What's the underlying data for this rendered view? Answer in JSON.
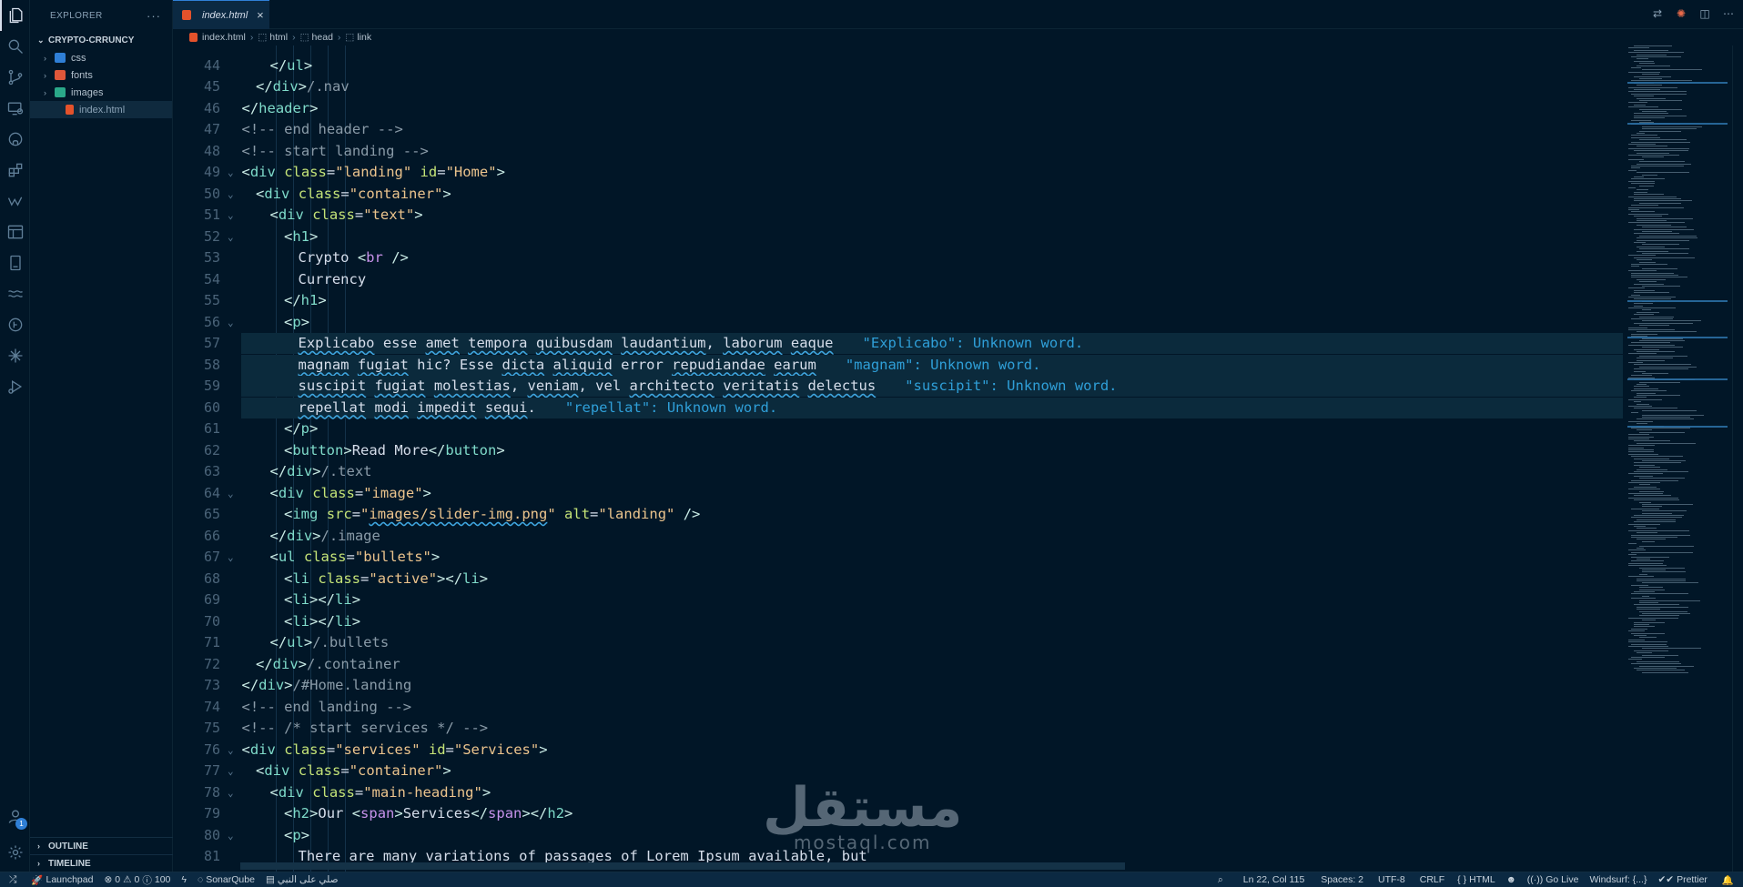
{
  "explorer": {
    "title": "EXPLORER",
    "more": "···",
    "project": "CRYPTO-CRRUNCY",
    "items": [
      {
        "label": "css",
        "type": "folder",
        "color": "#2f7fd6"
      },
      {
        "label": "fonts",
        "type": "folder",
        "color": "#e0573a"
      },
      {
        "label": "images",
        "type": "folder",
        "color": "#2aa889"
      },
      {
        "label": "index.html",
        "type": "file",
        "color": "#e4522b"
      }
    ],
    "outline": "OUTLINE",
    "timeline": "TIMELINE"
  },
  "tab": {
    "label": "index.html",
    "close": "×"
  },
  "breadcrumb": [
    "index.html",
    "html",
    "head",
    "link"
  ],
  "activity_badge": "1",
  "editor": {
    "lines": [
      {
        "n": "44",
        "fold": "",
        "tokens": [
          [
            "tg",
            "</"
          ],
          [
            "tn",
            "ul"
          ],
          [
            "tg",
            ">"
          ]
        ]
      },
      {
        "n": "45",
        "fold": "",
        "tokens": [
          [
            "tg",
            "</"
          ],
          [
            "tn",
            "div"
          ],
          [
            "tg",
            ">"
          ],
          [
            "cm",
            "/.nav"
          ]
        ]
      },
      {
        "n": "46",
        "fold": "",
        "tokens": [
          [
            "tg",
            "</"
          ],
          [
            "tn",
            "header"
          ],
          [
            "tg",
            ">"
          ]
        ]
      },
      {
        "n": "47",
        "fold": "",
        "tokens": [
          [
            "cm",
            "<!-- end header -->"
          ]
        ]
      },
      {
        "n": "48",
        "fold": "",
        "tokens": [
          [
            "cm",
            "<!-- start landing -->"
          ]
        ]
      },
      {
        "n": "49",
        "fold": "v",
        "tokens": [
          [
            "tg",
            "<"
          ],
          [
            "tn",
            "div"
          ],
          [
            "tx",
            " "
          ],
          [
            "at",
            "class"
          ],
          [
            "tx",
            "="
          ],
          [
            "st",
            "\"landing\""
          ],
          [
            "tx",
            " "
          ],
          [
            "at",
            "id"
          ],
          [
            "tx",
            "="
          ],
          [
            "st",
            "\"Home\""
          ],
          [
            "tg",
            ">"
          ]
        ]
      },
      {
        "n": "50",
        "fold": "v",
        "tokens": [
          [
            "tg",
            "<"
          ],
          [
            "tn",
            "div"
          ],
          [
            "tx",
            " "
          ],
          [
            "at",
            "class"
          ],
          [
            "tx",
            "="
          ],
          [
            "st",
            "\"container\""
          ],
          [
            "tg",
            ">"
          ]
        ]
      },
      {
        "n": "51",
        "fold": "v",
        "tokens": [
          [
            "tg",
            "<"
          ],
          [
            "tn",
            "div"
          ],
          [
            "tx",
            " "
          ],
          [
            "at",
            "class"
          ],
          [
            "tx",
            "="
          ],
          [
            "st",
            "\"text\""
          ],
          [
            "tg",
            ">"
          ]
        ]
      },
      {
        "n": "52",
        "fold": "v",
        "tokens": [
          [
            "tg",
            "<"
          ],
          [
            "tn",
            "h1"
          ],
          [
            "tg",
            ">"
          ]
        ]
      },
      {
        "n": "53",
        "fold": "",
        "tokens": [
          [
            "tx",
            "Crypto "
          ],
          [
            "tg",
            "<"
          ],
          [
            "ky",
            "br"
          ],
          [
            "tx",
            " "
          ],
          [
            "tg",
            "/>"
          ]
        ]
      },
      {
        "n": "54",
        "fold": "",
        "tokens": [
          [
            "tx",
            "Currency"
          ]
        ]
      },
      {
        "n": "55",
        "fold": "",
        "tokens": [
          [
            "tg",
            "</"
          ],
          [
            "tn",
            "h1"
          ],
          [
            "tg",
            ">"
          ]
        ]
      },
      {
        "n": "56",
        "fold": "v",
        "tokens": [
          [
            "tg",
            "<"
          ],
          [
            "tn",
            "p"
          ],
          [
            "tg",
            ">"
          ]
        ]
      },
      {
        "n": "57",
        "fold": "",
        "tokens": [
          [
            "tx sq",
            "Explicabo"
          ],
          [
            "tx",
            " esse "
          ],
          [
            "tx sq",
            "amet"
          ],
          [
            "tx",
            " "
          ],
          [
            "tx sq",
            "tempora"
          ],
          [
            "tx",
            " "
          ],
          [
            "tx sq",
            "quibusdam"
          ],
          [
            "tx",
            " "
          ],
          [
            "tx sq",
            "laudantium"
          ],
          [
            "tx",
            ", "
          ],
          [
            "tx sq",
            "laborum"
          ],
          [
            "tx",
            " "
          ],
          [
            "tx sq",
            "eaque"
          ]
        ],
        "hint": "\"Explicabo\": Unknown word."
      },
      {
        "n": "58",
        "fold": "",
        "tokens": [
          [
            "tx sq",
            "magnam"
          ],
          [
            "tx",
            " "
          ],
          [
            "tx sq",
            "fugiat"
          ],
          [
            "tx",
            " hic? Esse "
          ],
          [
            "tx sq",
            "dicta"
          ],
          [
            "tx",
            " "
          ],
          [
            "tx sq",
            "aliquid"
          ],
          [
            "tx",
            " error "
          ],
          [
            "tx sq",
            "repudiandae"
          ],
          [
            "tx",
            " "
          ],
          [
            "tx sq",
            "earum"
          ]
        ],
        "hint": "\"magnam\": Unknown word."
      },
      {
        "n": "59",
        "fold": "",
        "tokens": [
          [
            "tx sq",
            "suscipit"
          ],
          [
            "tx",
            " "
          ],
          [
            "tx sq",
            "fugiat"
          ],
          [
            "tx",
            " "
          ],
          [
            "tx sq",
            "molestias"
          ],
          [
            "tx",
            ", "
          ],
          [
            "tx sq",
            "veniam"
          ],
          [
            "tx",
            ", vel "
          ],
          [
            "tx sq",
            "architecto"
          ],
          [
            "tx",
            " "
          ],
          [
            "tx sq",
            "veritatis"
          ],
          [
            "tx",
            " "
          ],
          [
            "tx sq",
            "delectus"
          ]
        ],
        "hint": "\"suscipit\": Unknown word."
      },
      {
        "n": "60",
        "fold": "",
        "tokens": [
          [
            "tx sq",
            "repellat"
          ],
          [
            "tx",
            " "
          ],
          [
            "tx sq",
            "modi"
          ],
          [
            "tx",
            " "
          ],
          [
            "tx sq",
            "impedit"
          ],
          [
            "tx",
            " "
          ],
          [
            "tx sq",
            "sequi"
          ],
          [
            "tx",
            "."
          ]
        ],
        "hint": "\"repellat\": Unknown word."
      },
      {
        "n": "61",
        "fold": "",
        "tokens": [
          [
            "tg",
            "</"
          ],
          [
            "tn",
            "p"
          ],
          [
            "tg",
            ">"
          ]
        ]
      },
      {
        "n": "62",
        "fold": "",
        "tokens": [
          [
            "tg",
            "<"
          ],
          [
            "tn",
            "button"
          ],
          [
            "tg",
            ">"
          ],
          [
            "tx",
            "Read More"
          ],
          [
            "tg",
            "</"
          ],
          [
            "tn",
            "button"
          ],
          [
            "tg",
            ">"
          ]
        ]
      },
      {
        "n": "63",
        "fold": "",
        "tokens": [
          [
            "tg",
            "</"
          ],
          [
            "tn",
            "div"
          ],
          [
            "tg",
            ">"
          ],
          [
            "cm",
            "/.text"
          ]
        ]
      },
      {
        "n": "64",
        "fold": "v",
        "tokens": [
          [
            "tg",
            "<"
          ],
          [
            "tn",
            "div"
          ],
          [
            "tx",
            " "
          ],
          [
            "at",
            "class"
          ],
          [
            "tx",
            "="
          ],
          [
            "st",
            "\"image\""
          ],
          [
            "tg",
            ">"
          ]
        ]
      },
      {
        "n": "65",
        "fold": "",
        "tokens": [
          [
            "tg",
            "<"
          ],
          [
            "tn",
            "img"
          ],
          [
            "tx",
            " "
          ],
          [
            "at",
            "src"
          ],
          [
            "tx",
            "="
          ],
          [
            "st",
            "\""
          ],
          [
            "st sq2",
            "images/slider-img.png"
          ],
          [
            "st",
            "\""
          ],
          [
            "tx",
            " "
          ],
          [
            "at",
            "alt"
          ],
          [
            "tx",
            "="
          ],
          [
            "st",
            "\"landing\""
          ],
          [
            "tx",
            " "
          ],
          [
            "tg",
            "/>"
          ]
        ]
      },
      {
        "n": "66",
        "fold": "",
        "tokens": [
          [
            "tg",
            "</"
          ],
          [
            "tn",
            "div"
          ],
          [
            "tg",
            ">"
          ],
          [
            "cm",
            "/.image"
          ]
        ]
      },
      {
        "n": "67",
        "fold": "v",
        "tokens": [
          [
            "tg",
            "<"
          ],
          [
            "tn",
            "ul"
          ],
          [
            "tx",
            " "
          ],
          [
            "at",
            "class"
          ],
          [
            "tx",
            "="
          ],
          [
            "st",
            "\"bullets\""
          ],
          [
            "tg",
            ">"
          ]
        ]
      },
      {
        "n": "68",
        "fold": "",
        "tokens": [
          [
            "tg",
            "<"
          ],
          [
            "tn",
            "li"
          ],
          [
            "tx",
            " "
          ],
          [
            "at",
            "class"
          ],
          [
            "tx",
            "="
          ],
          [
            "st",
            "\"active\""
          ],
          [
            "tg",
            "></"
          ],
          [
            "tn",
            "li"
          ],
          [
            "tg",
            ">"
          ]
        ]
      },
      {
        "n": "69",
        "fold": "",
        "tokens": [
          [
            "tg",
            "<"
          ],
          [
            "tn",
            "li"
          ],
          [
            "tg",
            "></"
          ],
          [
            "tn",
            "li"
          ],
          [
            "tg",
            ">"
          ]
        ]
      },
      {
        "n": "70",
        "fold": "",
        "tokens": [
          [
            "tg",
            "<"
          ],
          [
            "tn",
            "li"
          ],
          [
            "tg",
            "></"
          ],
          [
            "tn",
            "li"
          ],
          [
            "tg",
            ">"
          ]
        ]
      },
      {
        "n": "71",
        "fold": "",
        "tokens": [
          [
            "tg",
            "</"
          ],
          [
            "tn",
            "ul"
          ],
          [
            "tg",
            ">"
          ],
          [
            "cm",
            "/.bullets"
          ]
        ]
      },
      {
        "n": "72",
        "fold": "",
        "tokens": [
          [
            "tg",
            "</"
          ],
          [
            "tn",
            "div"
          ],
          [
            "tg",
            ">"
          ],
          [
            "cm",
            "/.container"
          ]
        ]
      },
      {
        "n": "73",
        "fold": "",
        "tokens": [
          [
            "tg",
            "</"
          ],
          [
            "tn",
            "div"
          ],
          [
            "tg",
            ">"
          ],
          [
            "cm",
            "/#Home.landing"
          ]
        ]
      },
      {
        "n": "74",
        "fold": "",
        "tokens": [
          [
            "cm",
            "<!-- end landing -->"
          ]
        ]
      },
      {
        "n": "75",
        "fold": "",
        "tokens": [
          [
            "cm",
            "<!-- /* start services */ -->"
          ]
        ]
      },
      {
        "n": "76",
        "fold": "v",
        "tokens": [
          [
            "tg",
            "<"
          ],
          [
            "tn",
            "div"
          ],
          [
            "tx",
            " "
          ],
          [
            "at",
            "class"
          ],
          [
            "tx",
            "="
          ],
          [
            "st",
            "\"services\""
          ],
          [
            "tx",
            " "
          ],
          [
            "at",
            "id"
          ],
          [
            "tx",
            "="
          ],
          [
            "st",
            "\"Services\""
          ],
          [
            "tg",
            ">"
          ]
        ]
      },
      {
        "n": "77",
        "fold": "v",
        "tokens": [
          [
            "tg",
            "<"
          ],
          [
            "tn",
            "div"
          ],
          [
            "tx",
            " "
          ],
          [
            "at",
            "class"
          ],
          [
            "tx",
            "="
          ],
          [
            "st",
            "\"container\""
          ],
          [
            "tg",
            ">"
          ]
        ]
      },
      {
        "n": "78",
        "fold": "v",
        "tokens": [
          [
            "tg",
            "<"
          ],
          [
            "tn",
            "div"
          ],
          [
            "tx",
            " "
          ],
          [
            "at",
            "class"
          ],
          [
            "tx",
            "="
          ],
          [
            "st",
            "\"main-heading\""
          ],
          [
            "tg",
            ">"
          ]
        ]
      },
      {
        "n": "79",
        "fold": "",
        "tokens": [
          [
            "tg",
            "<"
          ],
          [
            "tn",
            "h2"
          ],
          [
            "tg",
            ">"
          ],
          [
            "tx",
            "Our "
          ],
          [
            "tg",
            "<"
          ],
          [
            "ky",
            "span"
          ],
          [
            "tg",
            ">"
          ],
          [
            "tx",
            "Services"
          ],
          [
            "tg",
            "</"
          ],
          [
            "ky",
            "span"
          ],
          [
            "tg",
            "></"
          ],
          [
            "tn",
            "h2"
          ],
          [
            "tg",
            ">"
          ]
        ]
      },
      {
        "n": "80",
        "fold": "v",
        "tokens": [
          [
            "tg",
            "<"
          ],
          [
            "tn",
            "p"
          ],
          [
            "tg",
            ">"
          ]
        ]
      },
      {
        "n": "81",
        "fold": "",
        "tokens": [
          [
            "tx",
            "There are many variations of passages of Lorem Ipsum available, but"
          ]
        ]
      }
    ]
  },
  "statusbar": {
    "launchpad": "Launchpad",
    "errors": "0",
    "warnings": "0",
    "info": "100",
    "sonar": "SonarQube",
    "arabic": "صلي على النبي",
    "cursor": "Ln 22, Col 115",
    "spaces": "Spaces: 2",
    "encoding": "UTF-8",
    "eol": "CRLF",
    "language": "HTML",
    "golive": "Go Live",
    "windsurf": "Windsurf: {...}",
    "prettier": "Prettier"
  },
  "watermark": {
    "arabic": "مستقل",
    "latin": "mostaql.com"
  }
}
